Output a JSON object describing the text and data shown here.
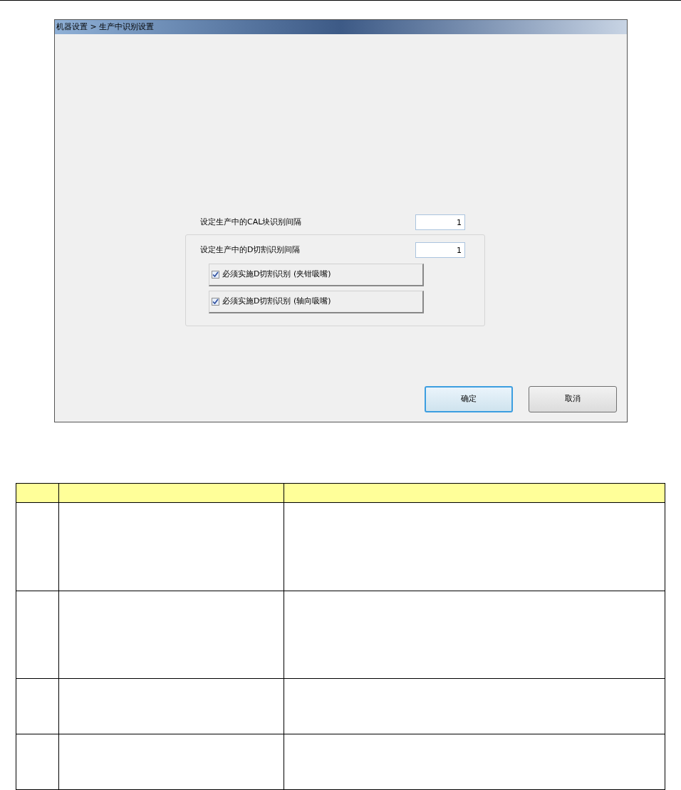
{
  "dialog": {
    "title": "机器设置 > 生产中识别设置",
    "cal_interval": {
      "label": "设定生产中的CAL块识别间隔",
      "value": "1"
    },
    "group": {
      "interval": {
        "label": "设定生产中的D切割识别间隔",
        "value": "1"
      },
      "checkboxes": [
        {
          "label": "必须实施D切割识别 (夹钳吸嘴)",
          "checked": true
        },
        {
          "label": "必须实施D切割识别 (轴向吸嘴)",
          "checked": true
        }
      ]
    },
    "buttons": [
      {
        "label": "确定",
        "selected": true
      },
      {
        "label": "取消",
        "selected": false
      }
    ]
  },
  "table": {
    "rows": [
      {
        "kind": "tall"
      },
      {
        "kind": "tall"
      },
      {
        "kind": "short"
      },
      {
        "kind": "short"
      }
    ]
  }
}
